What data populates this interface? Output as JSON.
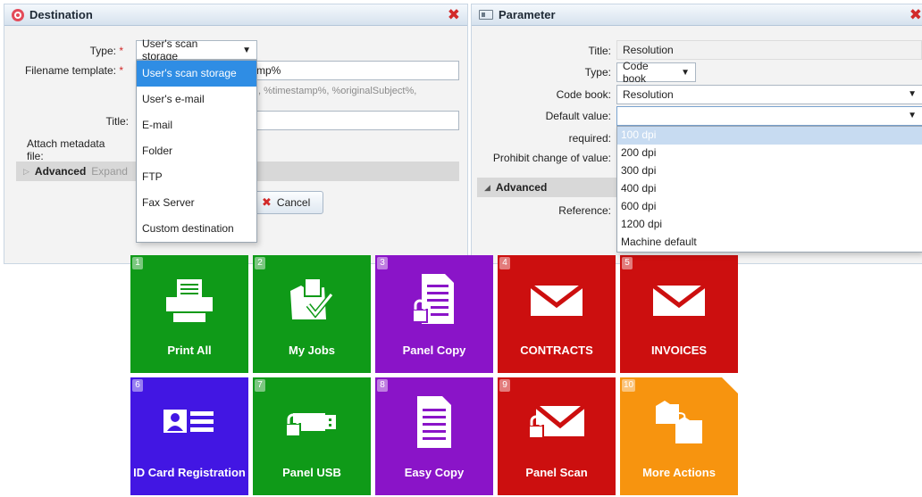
{
  "destination": {
    "title": "Destination",
    "type_label": "Type:",
    "type_value": "User's scan storage",
    "filename_label": "Filename template:",
    "filename_value": "mp%",
    "filename_hint": ", %timestamp%, %originalSubject%,",
    "title_label": "Title:",
    "attach_label": "Attach metadata file:",
    "advanced_label": "Advanced",
    "expand_label": "Expand",
    "cancel_label": "Cancel",
    "type_options": [
      "User's scan storage",
      "User's e-mail",
      "E-mail",
      "Folder",
      "FTP",
      "Fax Server",
      "Custom destination"
    ]
  },
  "parameter": {
    "title": "Parameter",
    "title_label": "Title:",
    "title_value": "Resolution",
    "type_label": "Type:",
    "type_value": "Code book",
    "codebook_label": "Code book:",
    "codebook_value": "Resolution",
    "default_label": "Default value:",
    "default_value": "",
    "required_label": "required:",
    "prohibit_label": "Prohibit change of value:",
    "advanced_label": "Advanced",
    "reference_label": "Reference:",
    "default_options": [
      "100 dpi",
      "200 dpi",
      "300 dpi",
      "400 dpi",
      "600 dpi",
      "1200 dpi",
      "Machine default"
    ]
  },
  "tiles": [
    {
      "num": "1",
      "label": "Print All",
      "color": "#0f9a18",
      "icon": "printer-icon"
    },
    {
      "num": "2",
      "label": "My Jobs",
      "color": "#0f9a18",
      "icon": "folder-check-icon"
    },
    {
      "num": "3",
      "label": "Panel Copy",
      "color": "#8a14c8",
      "icon": "document-lock-icon"
    },
    {
      "num": "4",
      "label": "CONTRACTS",
      "color": "#cc0f0f",
      "icon": "envelope-icon"
    },
    {
      "num": "5",
      "label": "INVOICES",
      "color": "#cc0f0f",
      "icon": "envelope-icon"
    },
    {
      "num": "6",
      "label": "ID Card Registration",
      "color": "#4216e3",
      "icon": "id-card-icon"
    },
    {
      "num": "7",
      "label": "Panel USB",
      "color": "#0f9a18",
      "icon": "usb-lock-icon"
    },
    {
      "num": "8",
      "label": "Easy Copy",
      "color": "#8a14c8",
      "icon": "document-icon"
    },
    {
      "num": "9",
      "label": "Panel Scan",
      "color": "#cc0f0f",
      "icon": "envelope-lock-icon"
    },
    {
      "num": "10",
      "label": "More Actions",
      "color": "#f7940f",
      "icon": "folders-icon"
    }
  ]
}
